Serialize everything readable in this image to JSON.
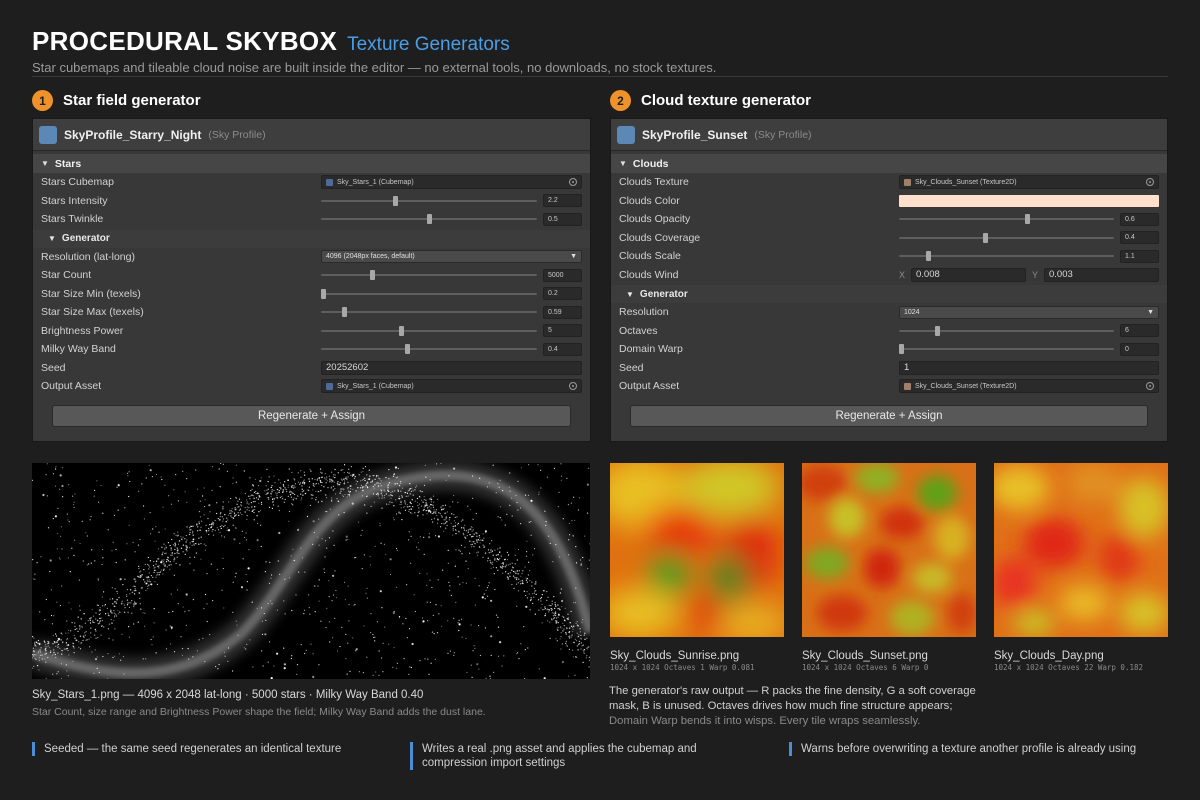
{
  "header": {
    "title": "PROCEDURAL SKYBOX",
    "subtitle": "Texture Generators",
    "tagline": "Star cubemaps and tileable cloud noise are built inside the editor — no external tools, no downloads, no stock textures."
  },
  "star_section": {
    "number": "1",
    "title": "Star field generator",
    "profile_name": "SkyProfile_Starry_Night",
    "profile_type": "(Sky Profile)",
    "group_label": "Stars",
    "fields": {
      "cubemap_label": "Stars Cubemap",
      "cubemap_value": "Sky_Stars_1 (Cubemap)",
      "intensity_label": "Stars Intensity",
      "intensity_value": "2.2",
      "intensity_fraction": 0.34,
      "twinkle_label": "Stars Twinkle",
      "twinkle_value": "0.5",
      "twinkle_fraction": 0.5
    },
    "generator_label": "Generator",
    "generator": {
      "resolution_label": "Resolution (lat-long)",
      "resolution_value": "4096 (2048px faces, default)",
      "star_count_label": "Star Count",
      "star_count_value": "5000",
      "star_count_fraction": 0.23,
      "size_min_label": "Star Size Min (texels)",
      "size_min_value": "0.2",
      "size_min_fraction": 0.0,
      "size_max_label": "Star Size Max (texels)",
      "size_max_value": "0.59",
      "size_max_fraction": 0.1,
      "brightness_label": "Brightness Power",
      "brightness_value": "5",
      "brightness_fraction": 0.37,
      "milky_label": "Milky Way Band",
      "milky_value": "0.4",
      "milky_fraction": 0.4,
      "seed_label": "Seed",
      "seed_value": "20252602",
      "output_label": "Output Asset",
      "output_value": "Sky_Stars_1 (Cubemap)"
    },
    "button_label": "Regenerate + Assign",
    "preview_caption": "Sky_Stars_1.png  —  4096 x 2048 lat-long   ·   5000 stars   ·   Milky Way Band 0.40",
    "preview_note": "Star Count, size range and Brightness Power shape the field; Milky Way Band adds the dust lane."
  },
  "cloud_section": {
    "number": "2",
    "title": "Cloud texture generator",
    "profile_name": "SkyProfile_Sunset",
    "profile_type": "(Sky Profile)",
    "group_label": "Clouds",
    "fields": {
      "texture_label": "Clouds Texture",
      "texture_value": "Sky_Clouds_Sunset (Texture2D)",
      "color_label": "Clouds Color",
      "color_value": "#ffe0cc",
      "opacity_label": "Clouds Opacity",
      "opacity_value": "0.6",
      "opacity_fraction": 0.6,
      "coverage_label": "Clouds Coverage",
      "coverage_value": "0.4",
      "coverage_fraction": 0.4,
      "scale_label": "Clouds Scale",
      "scale_value": "1.1",
      "scale_fraction": 0.13,
      "wind_label": "Clouds Wind",
      "wind_x_label": "X",
      "wind_x": "0.008",
      "wind_y_label": "Y",
      "wind_y": "0.003"
    },
    "generator_label": "Generator",
    "generator": {
      "resolution_label": "Resolution",
      "resolution_value": "1024",
      "octaves_label": "Octaves",
      "octaves_value": "6",
      "octaves_fraction": 0.17,
      "warp_label": "Domain Warp",
      "warp_value": "0",
      "warp_fraction": 0.0,
      "seed_label": "Seed",
      "seed_value": "1",
      "output_label": "Output Asset",
      "output_value": "Sky_Clouds_Sunset (Texture2D)"
    },
    "button_label": "Regenerate + Assign",
    "tiles": [
      {
        "name": "Sky_Clouds_Sunrise.png",
        "meta": "1024 x 1024   Octaves 1   Warp 0.081"
      },
      {
        "name": "Sky_Clouds_Sunset.png",
        "meta": "1024 x 1024   Octaves 6   Warp 0"
      },
      {
        "name": "Sky_Clouds_Day.png",
        "meta": "1024 x 1024   Octaves 22   Warp 0.182"
      }
    ],
    "explain_main": "The generator's raw output — R packs the fine density, G a soft coverage mask, B is unused. Octaves drives how much fine structure appears;",
    "explain_dim": "Domain Warp bends it into wisps. Every tile wraps seamlessly."
  },
  "notes": [
    "Seeded — the same seed regenerates an identical texture",
    "Writes a real .png asset and applies the cubemap and compression import settings",
    "Warns before overwriting a texture another profile is already using"
  ],
  "colors": {
    "accent_blue": "#4a9ee6",
    "step_orange": "#f0922b",
    "panel_bg": "#383838",
    "page_bg": "#1e1e1e"
  }
}
